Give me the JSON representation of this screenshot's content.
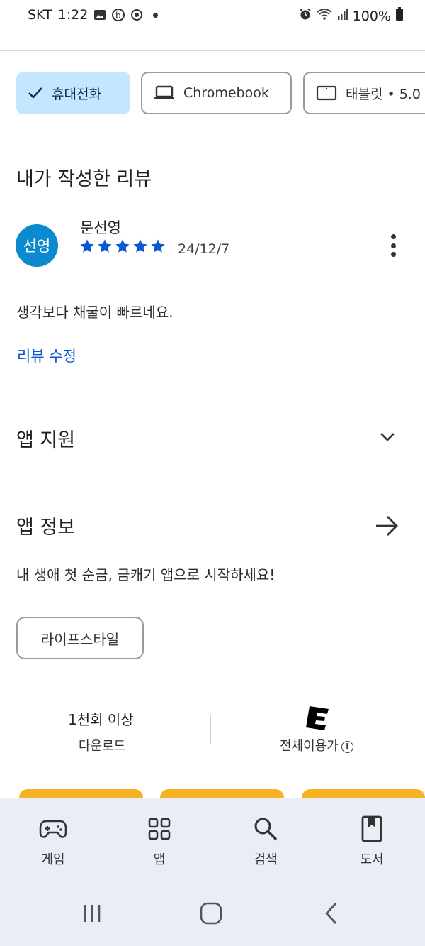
{
  "status_bar": {
    "carrier": "SKT",
    "time": "1:22",
    "battery": "100%",
    "notification_icons": [
      "gallery-icon",
      "b-app-icon",
      "sync-icon",
      "dot-icon"
    ],
    "system_icons": [
      "alarm-icon",
      "wifi-icon",
      "signal-icon",
      "battery-icon"
    ]
  },
  "device_chips": [
    {
      "label": "휴대전화",
      "icon": "check-icon",
      "selected": true
    },
    {
      "label": "Chromebook",
      "icon": "laptop-icon",
      "selected": false
    },
    {
      "label": "태블릿 • 5.0",
      "icon": "tablet-icon",
      "selected": false
    }
  ],
  "my_review": {
    "section_title": "내가 작성한 리뷰",
    "avatar_text": "선영",
    "reviewer_name": "문선영",
    "rating": 5,
    "date": "24/12/7",
    "text": "생각보다 채굴이 빠르네요.",
    "edit_label": "리뷰 수정"
  },
  "app_support": {
    "title": "앱 지원"
  },
  "app_info": {
    "title": "앱 정보",
    "description": "내 생애 첫 순금, 금캐기 앱으로 시작하세요!",
    "category": "라이프스타일",
    "downloads_value": "1천회 이상",
    "downloads_label": "다운로드",
    "rating_label": "전체이용가"
  },
  "bottom_nav": {
    "items": [
      {
        "label": "게임",
        "icon": "gamepad-icon"
      },
      {
        "label": "앱",
        "icon": "apps-grid-icon"
      },
      {
        "label": "검색",
        "icon": "search-icon"
      },
      {
        "label": "도서",
        "icon": "book-icon"
      }
    ]
  },
  "colors": {
    "accent": "#0b57d0",
    "selected_chip": "#c2e7ff",
    "avatar": "#0b8ad0",
    "star": "#0b57d0",
    "promo": "#f5b324",
    "nav_bg": "#e9eef6"
  }
}
